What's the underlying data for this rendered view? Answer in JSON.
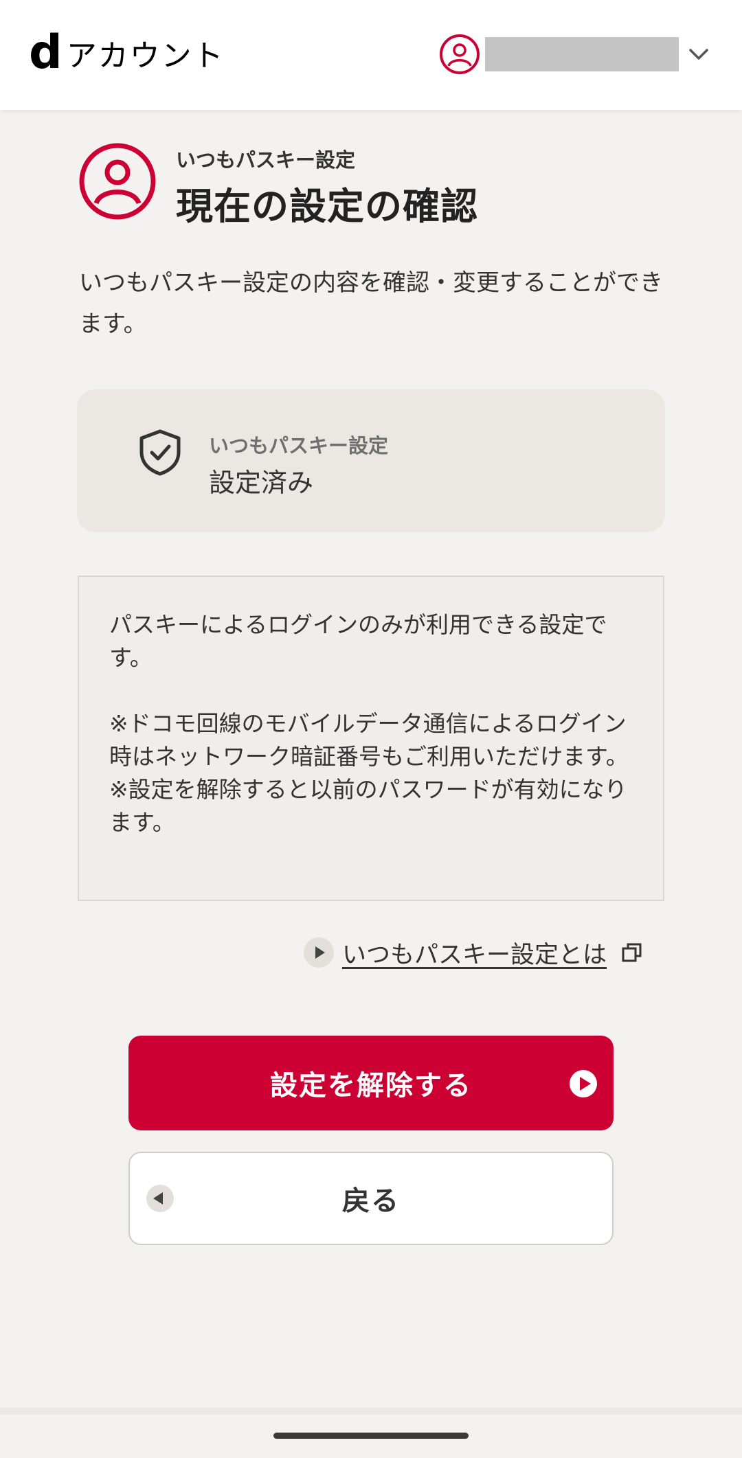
{
  "header": {
    "logo_letter": "d",
    "logo_text": "アカウント"
  },
  "page": {
    "subtitle": "いつもパスキー設定",
    "title": "現在の設定の確認",
    "description": "いつもパスキー設定の内容を確認・変更することができます。"
  },
  "status": {
    "label": "いつもパスキー設定",
    "value": "設定済み"
  },
  "notice": {
    "line1": "パスキーによるログインのみが利用できる設定です。",
    "line2": "※ドコモ回線のモバイルデータ通信によるログイン時はネットワーク暗証番号もご利用いただけます。",
    "line3": "※設定を解除すると以前のパスワードが有効になります。"
  },
  "help": {
    "link_text": "いつもパスキー設定とは"
  },
  "buttons": {
    "remove_label": "設定を解除する",
    "back_label": "戻る"
  },
  "colors": {
    "brand": "#cc0033",
    "background": "#f3f2f1",
    "card": "#ebe8e4"
  },
  "icons": {
    "avatar": "user-circle-icon",
    "account_menu": "chevron-down-icon",
    "page": "user-circle-icon",
    "status": "shield-check-icon",
    "help_bullet": "play-circle-icon",
    "external": "external-window-icon"
  }
}
